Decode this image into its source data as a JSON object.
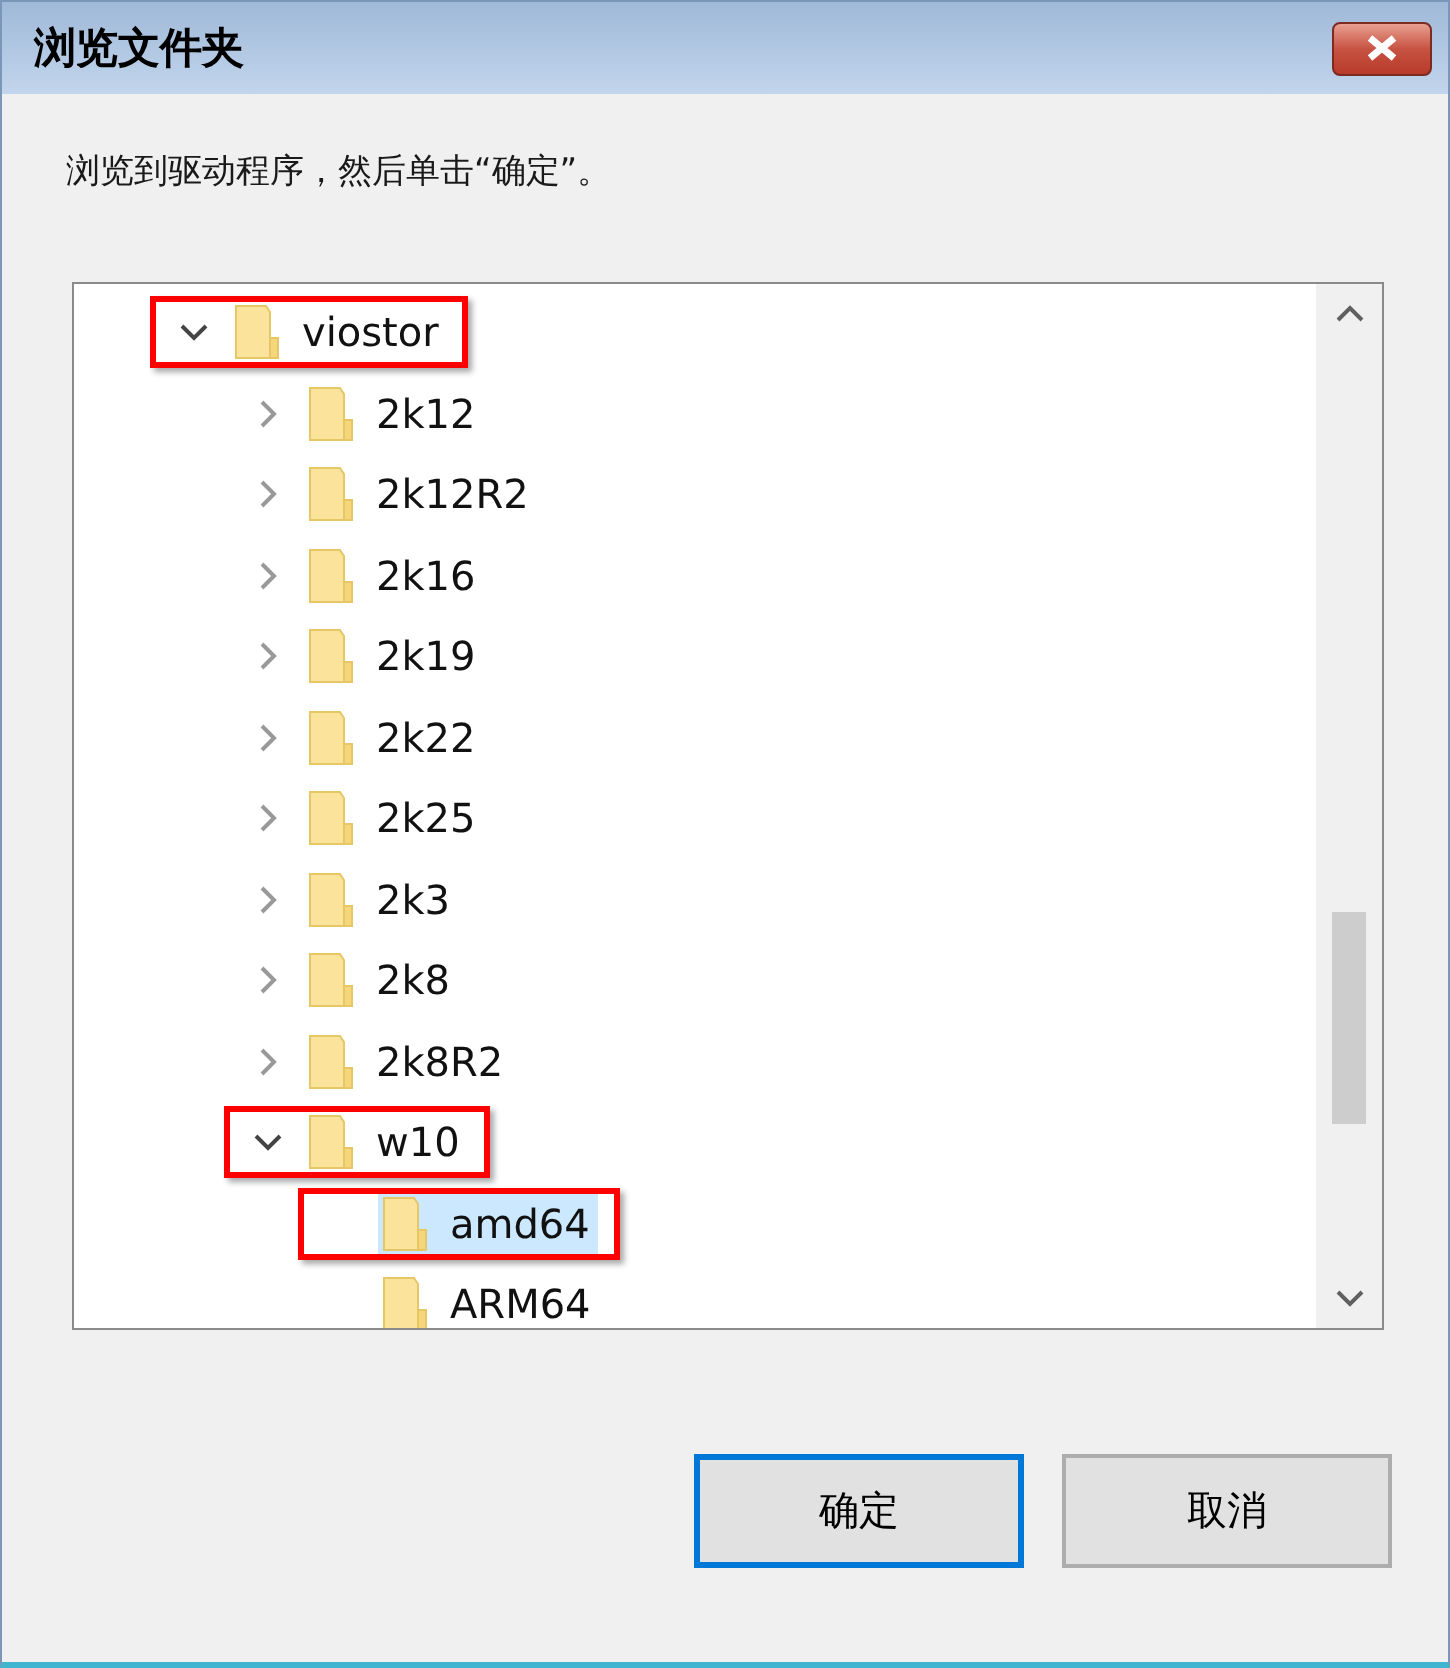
{
  "window": {
    "title": "浏览文件夹"
  },
  "instruction": "浏览到驱动程序，然后单击“确定”。",
  "tree": [
    {
      "label": "viostor",
      "expandable": true,
      "expanded": true,
      "selected": false,
      "highlighted": true,
      "children": [
        {
          "label": "2k12",
          "expandable": true,
          "expanded": false,
          "selected": false,
          "highlighted": false
        },
        {
          "label": "2k12R2",
          "expandable": true,
          "expanded": false,
          "selected": false,
          "highlighted": false
        },
        {
          "label": "2k16",
          "expandable": true,
          "expanded": false,
          "selected": false,
          "highlighted": false
        },
        {
          "label": "2k19",
          "expandable": true,
          "expanded": false,
          "selected": false,
          "highlighted": false
        },
        {
          "label": "2k22",
          "expandable": true,
          "expanded": false,
          "selected": false,
          "highlighted": false
        },
        {
          "label": "2k25",
          "expandable": true,
          "expanded": false,
          "selected": false,
          "highlighted": false
        },
        {
          "label": "2k3",
          "expandable": true,
          "expanded": false,
          "selected": false,
          "highlighted": false
        },
        {
          "label": "2k8",
          "expandable": true,
          "expanded": false,
          "selected": false,
          "highlighted": false
        },
        {
          "label": "2k8R2",
          "expandable": true,
          "expanded": false,
          "selected": false,
          "highlighted": false
        },
        {
          "label": "w10",
          "expandable": true,
          "expanded": true,
          "selected": false,
          "highlighted": true,
          "children": [
            {
              "label": "amd64",
              "expandable": false,
              "selected": true,
              "highlighted": true
            },
            {
              "label": "ARM64",
              "expandable": false,
              "selected": false,
              "highlighted": false
            }
          ]
        }
      ]
    }
  ],
  "buttons": [
    {
      "label": "确定",
      "default": true
    },
    {
      "label": "取消",
      "default": false
    }
  ]
}
